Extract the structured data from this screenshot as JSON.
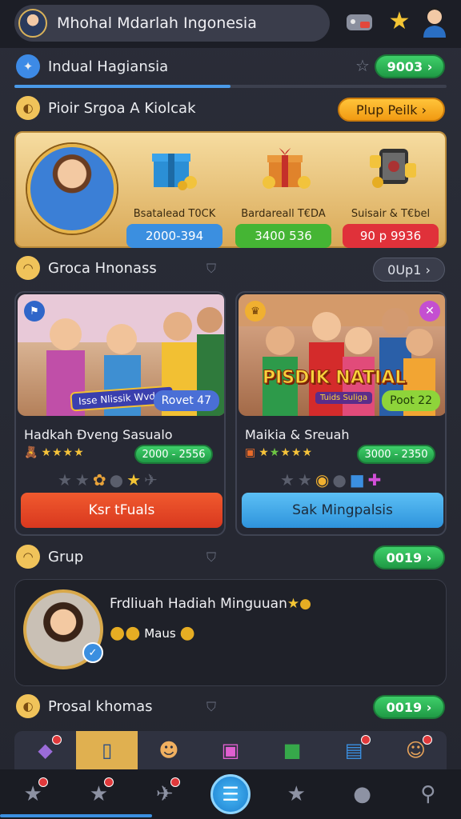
{
  "header": {
    "title": "Mhohal Mdarlah Ingonesia",
    "icons": [
      "game-controller-icon",
      "star-icon",
      "profile-icon"
    ]
  },
  "section1": {
    "title": "Indual Hagiansia",
    "value": "9003",
    "chevron": "›",
    "progress": 0.5
  },
  "section2": {
    "title": "Pioir Srgoa A Kiolcak",
    "button": "Plup Peilk ›"
  },
  "offers": [
    {
      "label": "Bsatalead T0CK",
      "price": "2000-394",
      "color": "#3b8fe0"
    },
    {
      "label": "Bardareall T€DA",
      "price": "3400 536",
      "color": "#45b534"
    },
    {
      "label": "Suisair & T€bel",
      "price": "90 p 9936",
      "color": "#e0313a"
    }
  ],
  "section3": {
    "title": "Groca Hnonass",
    "button": "0Up1 ›"
  },
  "cards": [
    {
      "banner": "Isse Nlissik Wvdgs",
      "badge": "Rovet 47",
      "title": "Hadkah Đveng Sasualo",
      "price": "2000 - 2556",
      "cta": "Ksr tFuals"
    },
    {
      "banner": "PISDIK NATIAL",
      "banner_sub": "Tuids Suliga",
      "badge": "Poot 22",
      "title": "Maikia & Sreuah",
      "price": "3000 - 2350",
      "cta": "Sak Mingpalsis"
    }
  ],
  "section4": {
    "title": "Grup",
    "value": "0019 ›"
  },
  "reward": {
    "title": "Frdliuah Hadiah Minguuan",
    "sub": "Maus"
  },
  "section5": {
    "title": "Prosal khomas",
    "value": "0019 ›"
  },
  "tabs": [
    "toy-icon",
    "tablet-icon",
    "gift-character-icon",
    "gift-icon",
    "green-box-icon",
    "mailbox-icon",
    "mascot-icon"
  ],
  "nav": [
    "star-icon",
    "star-icon",
    "wrench-icon",
    "clipboard-icon",
    "star-icon",
    "user-icon",
    "search-icon"
  ]
}
